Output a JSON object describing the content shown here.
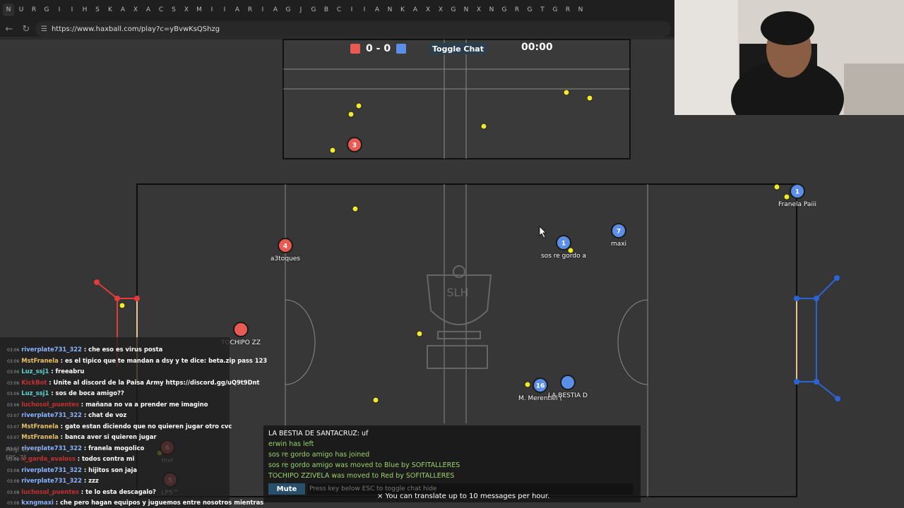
{
  "browser": {
    "url": "https://www.haxball.com/play?c=yBvwKsQShzg",
    "tab_icons": [
      "N",
      "U",
      "R",
      "G",
      "I",
      "I",
      "H",
      "S",
      "K",
      "A",
      "X",
      "A",
      "C",
      "S",
      "X",
      "M",
      "I",
      "I",
      "A",
      "R",
      "I",
      "A",
      "G",
      "J",
      "G",
      "B",
      "C",
      "I",
      "I",
      "A",
      "N",
      "K",
      "A",
      "X",
      "X",
      "G",
      "N",
      "X",
      "N",
      "G",
      "R",
      "G",
      "T",
      "G",
      "R",
      "N"
    ]
  },
  "game": {
    "score_red": "0",
    "score_sep": "-",
    "score_blue": "0",
    "toggle_chat_label": "Toggle Chat",
    "timer": "00:00",
    "red_color": "#e85a52",
    "blue_color": "#5b8ee6",
    "players": [
      {
        "name": "a3toques",
        "team": "red",
        "number": "4"
      },
      {
        "name": "TOCHIPO ZZ",
        "team": "red",
        "number": ""
      },
      {
        "name": "",
        "team": "red",
        "number": "3"
      },
      {
        "name": "sos re gordo a",
        "team": "blue",
        "number": "1"
      },
      {
        "name": "maxi",
        "team": "blue",
        "number": "7"
      },
      {
        "name": "Franela Paiii",
        "team": "blue",
        "number": "1"
      },
      {
        "name": "M. Merentiel (",
        "team": "blue",
        "number": "16"
      },
      {
        "name": "LA BESTIA D",
        "team": "blue",
        "number": ""
      },
      {
        "name": "mvr",
        "team": "red",
        "number": "6"
      },
      {
        "name": "LP5™",
        "team": "red",
        "number": "5"
      }
    ],
    "logo_text": "SLH"
  },
  "chat": {
    "lines": [
      {
        "time": "03:06",
        "user": "riverplate731_322",
        "user_color": "#8ab3ff",
        "msg": "che eso es virus posta"
      },
      {
        "time": "03:06",
        "user": "MstFranela",
        "user_color": "#e8c166",
        "msg": "es el tipico que te mandan a dsy y te dice: beta.zip pass 123"
      },
      {
        "time": "03:06",
        "user": "Luz_ssj1",
        "user_color": "#5dd6d6",
        "msg": "freeabru"
      },
      {
        "time": "03:06",
        "user": "KickBot",
        "user_color": "#c43030",
        "msg": "Unite al discord de la Paisa Army https://discord.gg/uQ9t9Dnt"
      },
      {
        "time": "03:06",
        "user": "Luz_ssj1",
        "user_color": "#5dd6d6",
        "msg": "sos de boca amigo??"
      },
      {
        "time": "03:06",
        "user": "luchosol_puentes",
        "user_color": "#c43030",
        "msg": "mañana no va a prender me imagino"
      },
      {
        "time": "03:07",
        "user": "riverplate731_322",
        "user_color": "#8ab3ff",
        "msg": "chat de voz"
      },
      {
        "time": "03:07",
        "user": "MstFranela",
        "user_color": "#e8c166",
        "msg": "gato estan diciendo que no quieren jugar otro cvc"
      },
      {
        "time": "03:07",
        "user": "MstFranela",
        "user_color": "#e8c166",
        "msg": "banca aver si quieren jugar"
      },
      {
        "time": "03:07",
        "user": "riverplate731_322",
        "user_color": "#8ab3ff",
        "msg": "franela mogolico"
      },
      {
        "time": "03:08",
        "user": "x_garda_avaloss",
        "user_color": "#c43030",
        "msg": "todos contra mi"
      },
      {
        "time": "03:08",
        "user": "riverplate731_322",
        "user_color": "#8ab3ff",
        "msg": "hijitos son jaja"
      },
      {
        "time": "03:08",
        "user": "riverplate731_322",
        "user_color": "#8ab3ff",
        "msg": "zzz"
      },
      {
        "time": "03:08",
        "user": "luchosol_puentes",
        "user_color": "#c43030",
        "msg": "te lo esta descagalo?"
      },
      {
        "time": "03:08",
        "user": "kxngmaxi",
        "user_color": "#8ab3ff",
        "msg": "che pero hagan equipos y juguemos entre nosotros mientras"
      }
    ],
    "ping": "Ping: 43 - 72",
    "fps": "FPS: 75"
  },
  "system": {
    "messages": [
      {
        "text": "LA BESTIA DE SANTACRUZ: uf",
        "color": "#ffffff"
      },
      {
        "text": "erwin has left",
        "color": "#9ad36a"
      },
      {
        "text": "sos re gordo amigo has joined",
        "color": "#9ad36a"
      },
      {
        "text": "sos re gordo amigo was moved to Blue by SOFITALLERES",
        "color": "#9ad36a"
      },
      {
        "text": "TOCHIPO ZZIVELA was moved to Red by SOFITALLERES",
        "color": "#9ad36a"
      }
    ],
    "mute_label": "Mute",
    "input_placeholder": "Press key below ESC to toggle chat hide"
  },
  "translate_note": "× You can translate up to 10 messages per hour."
}
